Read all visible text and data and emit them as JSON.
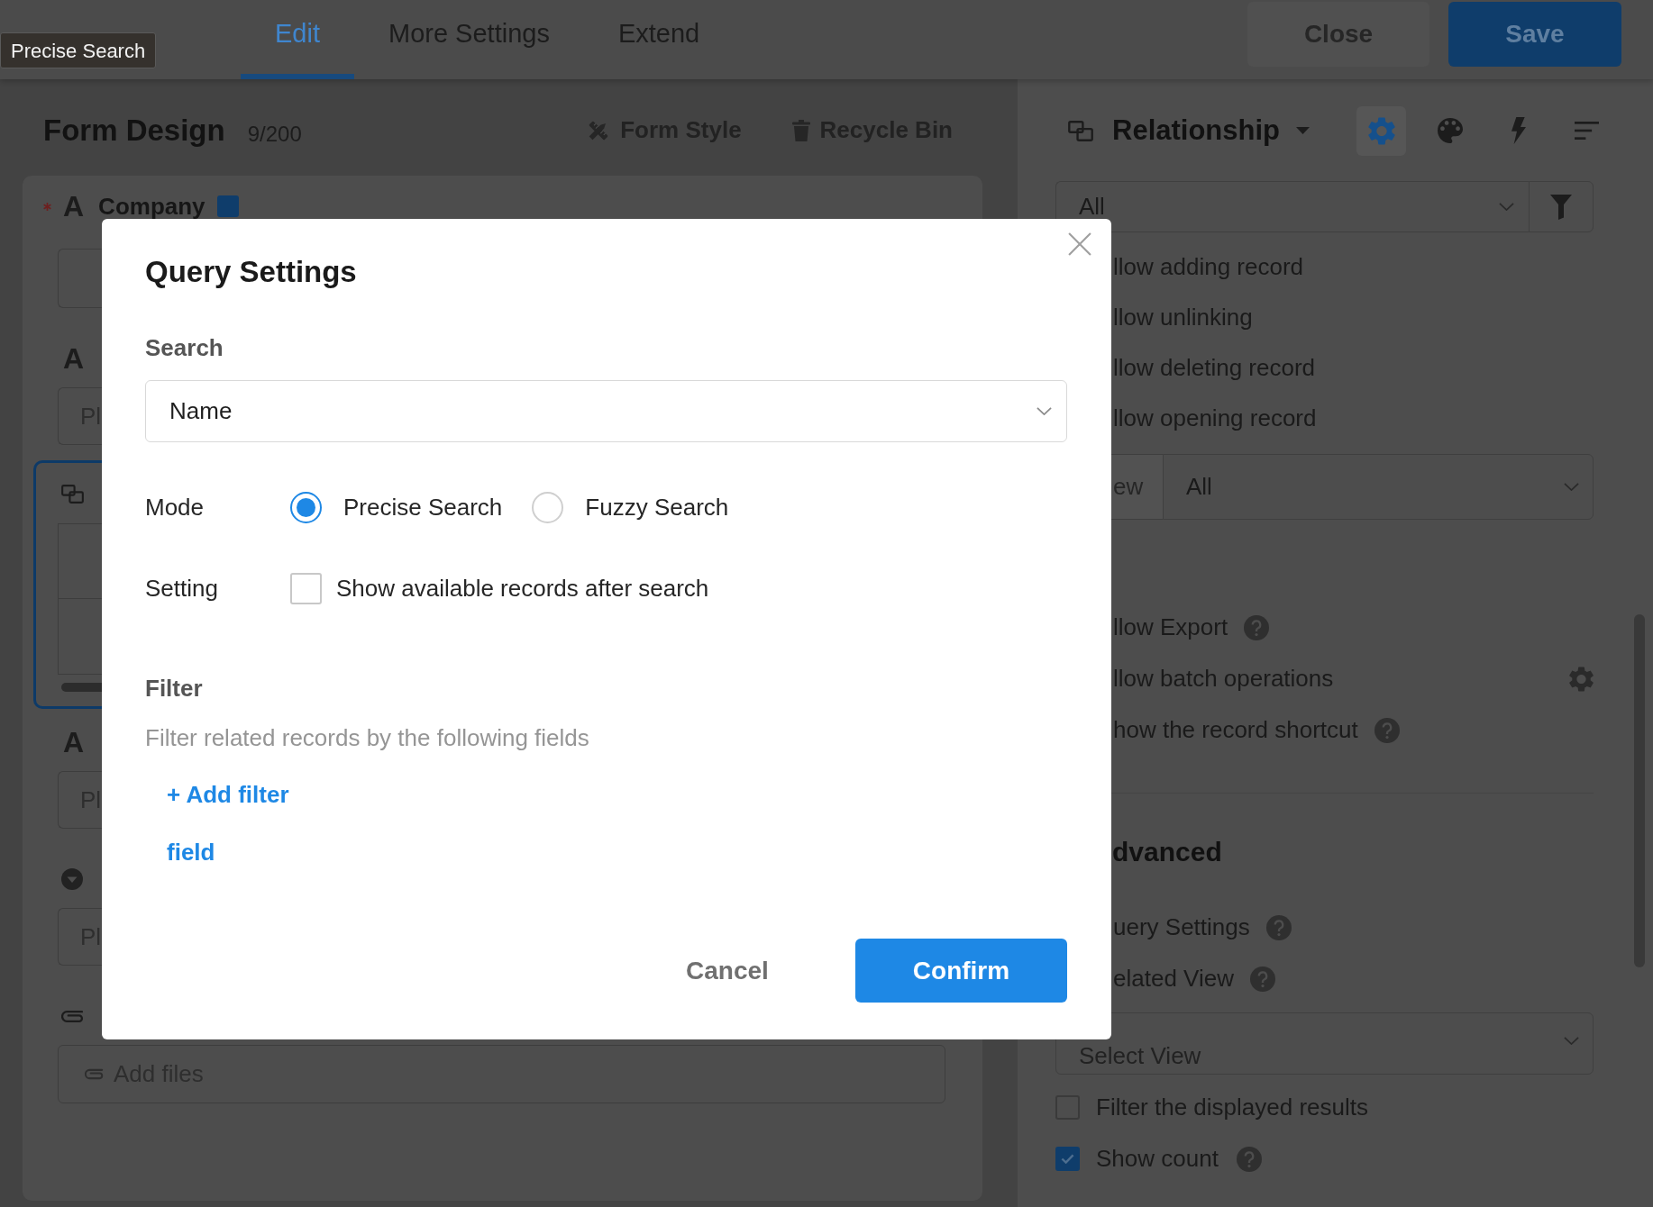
{
  "tooltip": {
    "text": "Precise Search"
  },
  "top_bar": {
    "tabs": [
      {
        "label": "Edit",
        "selected": true
      },
      {
        "label": "More Settings",
        "selected": false
      },
      {
        "label": "Extend",
        "selected": false
      }
    ],
    "buttons": [
      {
        "label": "Close",
        "kind": "secondary"
      },
      {
        "label": "Save",
        "kind": "primary"
      }
    ]
  },
  "form_design": {
    "title": "Form Design",
    "count": "9/200",
    "actions": [
      {
        "label": "Form Style",
        "kind": "style"
      },
      {
        "label": "Recycle Bin",
        "kind": "trash"
      }
    ],
    "fields": [
      {
        "kind": "text",
        "type_icon": "A",
        "label": "Company",
        "required": true,
        "tagged": true,
        "selected": false
      },
      {
        "kind": "text",
        "type_icon": "A",
        "placeholder": "Pl",
        "required": false,
        "selected": false
      },
      {
        "kind": "relation",
        "required": false,
        "selected": true
      },
      {
        "kind": "text",
        "type_icon": "A",
        "placeholder": "Pl",
        "required": false,
        "selected": false
      },
      {
        "kind": "dropdown",
        "placeholder": "Pl",
        "required": false,
        "selected": false
      },
      {
        "kind": "attachment",
        "placeholder": "Add files",
        "required": false,
        "selected": false
      }
    ]
  },
  "relationship_panel": {
    "title": "Relationship",
    "tools": [
      {
        "kind": "settings",
        "selected": true
      },
      {
        "kind": "palette",
        "selected": false
      },
      {
        "kind": "flash",
        "selected": false
      },
      {
        "kind": "sort",
        "selected": false
      }
    ],
    "view_filter": {
      "value": "All"
    },
    "permissions": [
      "llow adding record",
      "llow unlinking",
      "llow deleting record",
      "llow opening record"
    ],
    "view_select": {
      "label": "ew",
      "value": "All"
    },
    "options": [
      {
        "label": "llow Export",
        "kind": "help"
      },
      {
        "label": "llow batch operations",
        "kind": "settings"
      },
      {
        "label": "how the record shortcut",
        "kind": "help"
      }
    ],
    "advanced": {
      "title": "dvanced",
      "items": [
        {
          "label": "uery Settings",
          "kind": "help"
        },
        {
          "label": "elated View",
          "kind": "help"
        }
      ]
    },
    "view_dropdown": {
      "placeholder": "Select View"
    },
    "checks": [
      {
        "label": "Filter the displayed results",
        "checked": false,
        "help": false
      },
      {
        "label": "Show count",
        "checked": true,
        "help": true
      }
    ]
  },
  "dialog": {
    "title": "Query Settings",
    "search": {
      "label": "Search",
      "value": "Name"
    },
    "mode": {
      "label": "Mode",
      "options": [
        {
          "label": "Precise Search",
          "selected": true
        },
        {
          "label": "Fuzzy Search",
          "selected": false
        }
      ]
    },
    "setting": {
      "label": "Setting",
      "options": [
        {
          "label": "Show available records after search",
          "checked": false
        }
      ]
    },
    "filter": {
      "title": "Filter",
      "hint": "Filter related records by the following fields",
      "links": [
        "+ Add filter",
        "field"
      ]
    },
    "buttons": [
      {
        "label": "Cancel",
        "kind": "text"
      },
      {
        "label": "Confirm",
        "kind": "primary"
      }
    ]
  }
}
